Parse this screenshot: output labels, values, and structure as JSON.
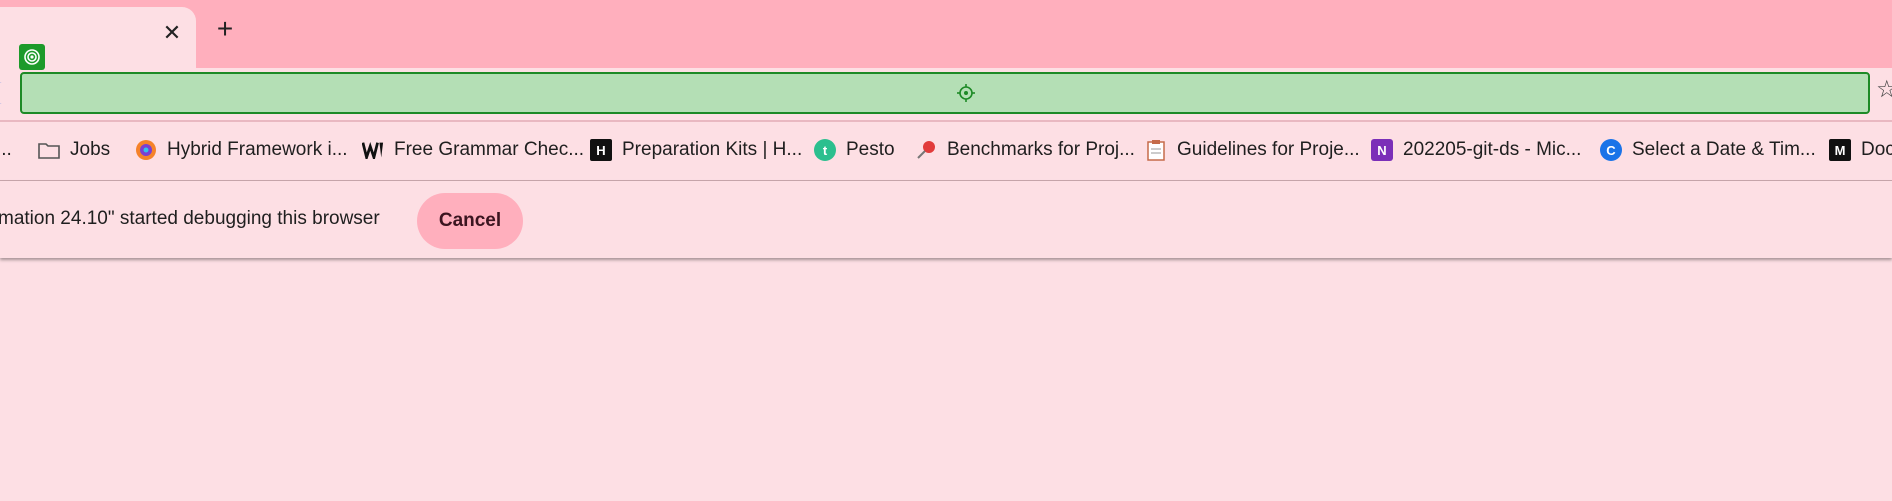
{
  "tabstrip": {
    "close_glyph": "✕",
    "new_tab_glyph": "+"
  },
  "toolbar": {
    "star_glyph": "☆"
  },
  "bookmarks": [
    {
      "label": "...",
      "icon": "truncated"
    },
    {
      "label": "Jobs",
      "icon": "folder-icon"
    },
    {
      "label": "Hybrid Framework i...",
      "icon": "firefox-like-icon"
    },
    {
      "label": "Free Grammar Chec...",
      "icon": "w-logo-icon"
    },
    {
      "label": "Preparation Kits | H...",
      "icon": "hackerrank-icon",
      "glyph": "H"
    },
    {
      "label": "Pesto",
      "icon": "pesto-icon",
      "glyph": "t"
    },
    {
      "label": "Benchmarks for Proj...",
      "icon": "pushpin-icon"
    },
    {
      "label": "Guidelines for Proje...",
      "icon": "clipboard-icon"
    },
    {
      "label": "202205-git-ds - Mic...",
      "icon": "onenote-icon",
      "glyph": "N"
    },
    {
      "label": "Select a Date & Tim...",
      "icon": "calendly-icon",
      "glyph": "C"
    },
    {
      "label": "Doc",
      "icon": "m-logo-icon",
      "glyph": "M"
    }
  ],
  "infobar": {
    "text": "mation 24.10\" started debugging this browser",
    "cancel_label": "Cancel"
  },
  "colors": {
    "tabstrip_bg": "#ffafbd",
    "page_bg": "#fddfe4",
    "omnibox_fill": "#b4dfb5",
    "omnibox_border": "#1d8a26",
    "cancel_bg": "#ffafbd"
  }
}
